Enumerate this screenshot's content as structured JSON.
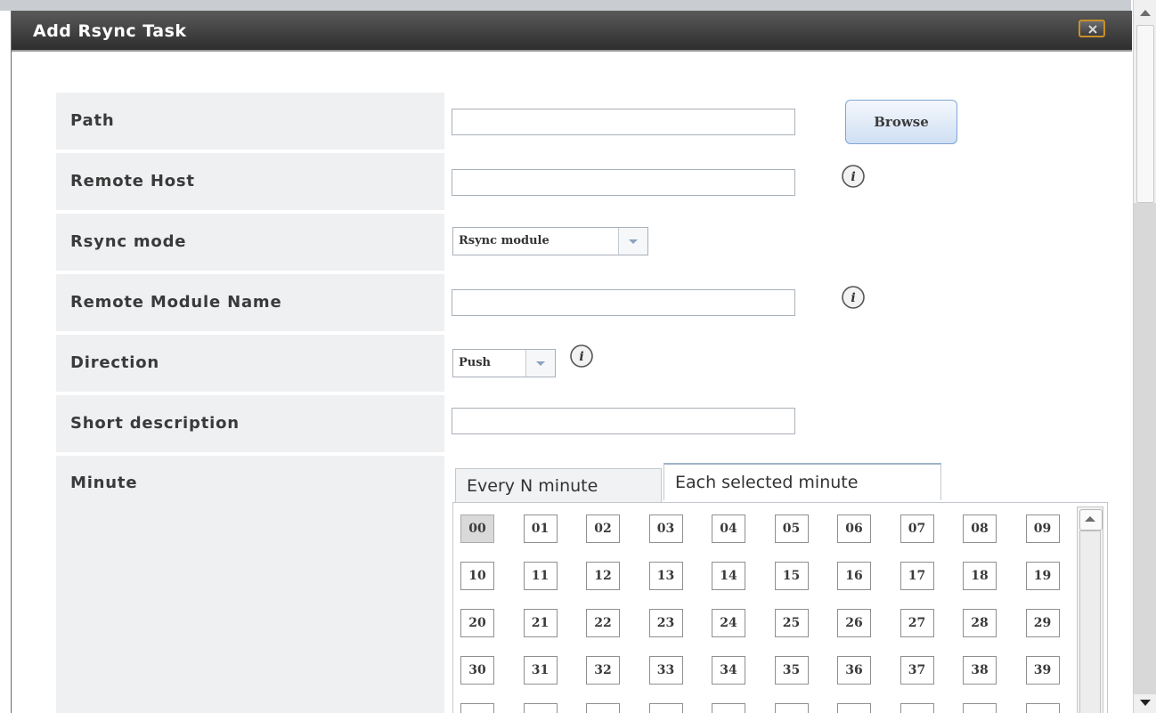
{
  "dialog": {
    "title": "Add Rsync Task",
    "close_icon": "close-icon"
  },
  "form": {
    "path": {
      "label": "Path",
      "value": "",
      "button_label": "Browse"
    },
    "remote_host": {
      "label": "Remote Host",
      "value": "",
      "icon": "info-icon"
    },
    "rsync_mode": {
      "label": "Rsync mode",
      "selected": "Rsync module"
    },
    "remote_module_name": {
      "label": "Remote Module Name",
      "value": "",
      "icon": "info-icon"
    },
    "direction": {
      "label": "Direction",
      "selected": "Push",
      "icon": "info-icon"
    },
    "short_description": {
      "label": "Short description",
      "value": ""
    },
    "minute": {
      "label": "Minute",
      "tabs": [
        "Every N minute",
        "Each selected minute"
      ],
      "active_tab": "Each selected minute",
      "values": [
        "00",
        "01",
        "02",
        "03",
        "04",
        "05",
        "06",
        "07",
        "08",
        "09",
        "10",
        "11",
        "12",
        "13",
        "14",
        "15",
        "16",
        "17",
        "18",
        "19",
        "20",
        "21",
        "22",
        "23",
        "24",
        "25",
        "26",
        "27",
        "28",
        "29",
        "30",
        "31",
        "32",
        "33",
        "34",
        "35",
        "36",
        "37",
        "38",
        "39"
      ],
      "selected": [
        "00"
      ]
    }
  },
  "colors": {
    "titlebar": "#3c3c3c",
    "label_bg": "#eef0f2",
    "button_border": "#7fa6d6",
    "close_border": "#c98f2a"
  }
}
